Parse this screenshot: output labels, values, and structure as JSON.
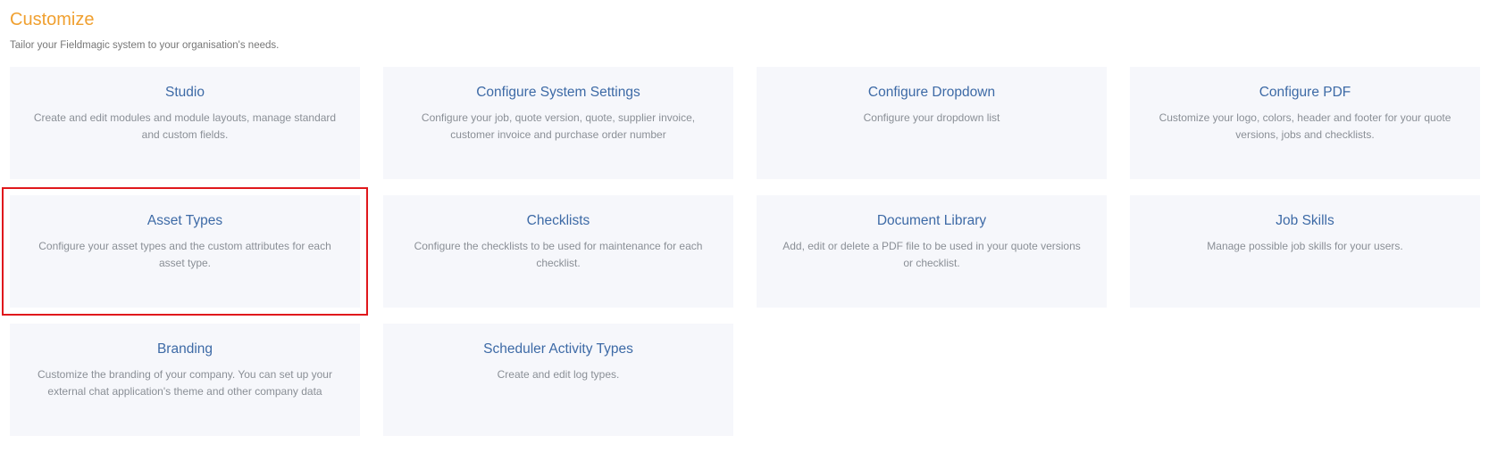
{
  "header": {
    "title": "Customize",
    "subtitle": "Tailor your Fieldmagic system to your organisation's needs."
  },
  "cards": [
    {
      "title": "Studio",
      "description": "Create and edit modules and module layouts, manage standard and custom fields."
    },
    {
      "title": "Configure System Settings",
      "description": "Configure your job, quote version, quote, supplier invoice, customer invoice and purchase order number"
    },
    {
      "title": "Configure Dropdown",
      "description": "Configure your dropdown list"
    },
    {
      "title": "Configure PDF",
      "description": "Customize your logo, colors, header and footer for your quote versions, jobs and checklists."
    },
    {
      "title": "Asset Types",
      "description": "Configure your asset types and the custom attributes for each asset type."
    },
    {
      "title": "Checklists",
      "description": "Configure the checklists to be used for maintenance for each checklist."
    },
    {
      "title": "Document Library",
      "description": "Add, edit or delete a PDF file to be used in your quote versions or checklist."
    },
    {
      "title": "Job Skills",
      "description": "Manage possible job skills for your users."
    },
    {
      "title": "Branding",
      "description": "Customize the branding of your company. You can set up your external chat application's theme and other company data"
    },
    {
      "title": "Scheduler Activity Types",
      "description": "Create and edit log types."
    }
  ],
  "colors": {
    "title_accent": "#f0a030",
    "card_title": "#3d6aa6",
    "card_background": "#f6f7fb",
    "highlight_border": "#e0181c"
  }
}
